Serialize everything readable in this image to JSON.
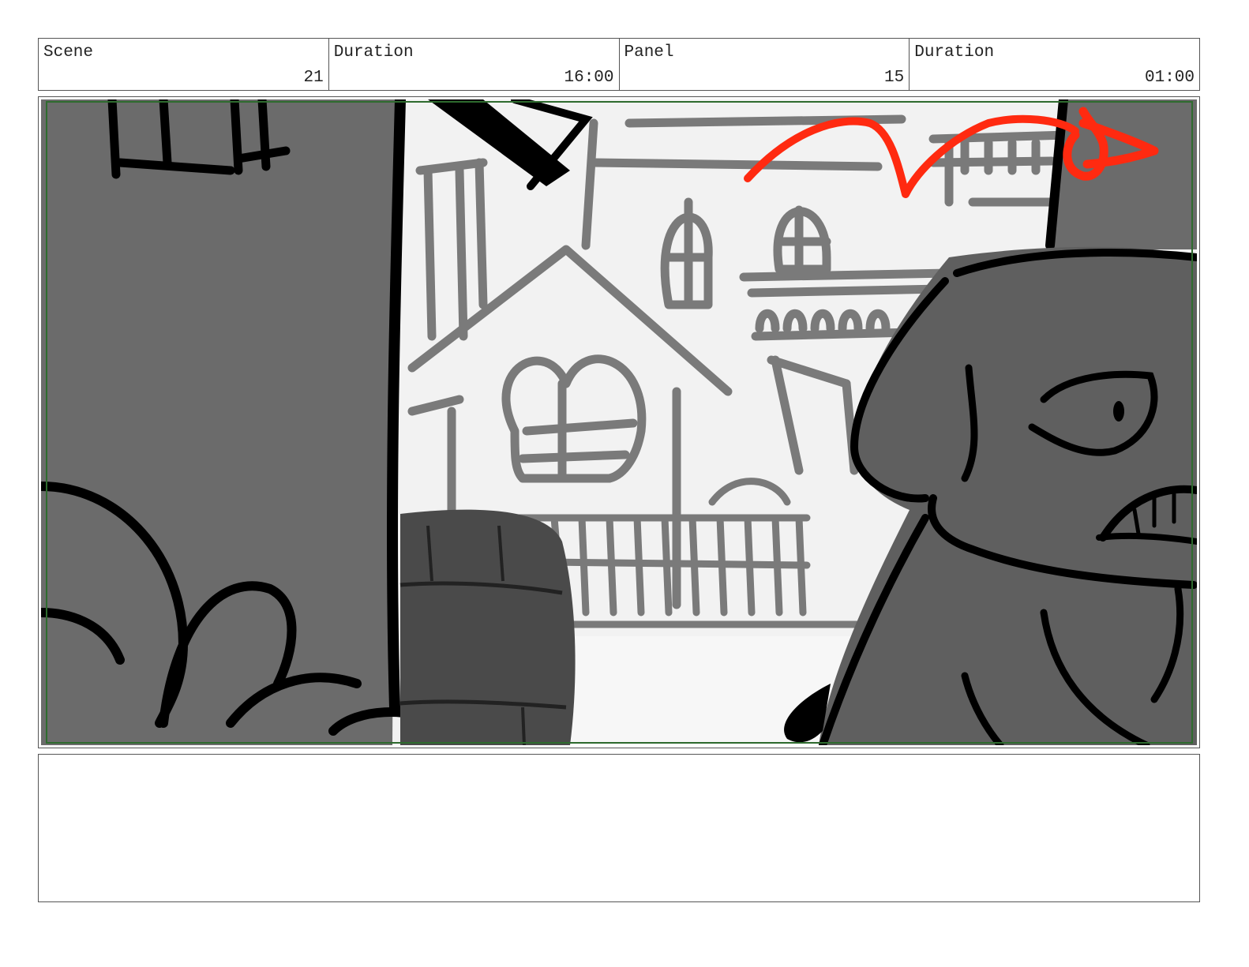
{
  "header": {
    "scene_label": "Scene",
    "scene_value": "21",
    "scene_duration_label": "Duration",
    "scene_duration_value": "16:00",
    "panel_label": "Panel",
    "panel_value": "15",
    "panel_duration_label": "Duration",
    "panel_duration_value": "01:00"
  },
  "panel": {
    "colors": {
      "safe_area_border": "#2e6b2e",
      "camera_move_arrow": "#ff2a10",
      "ink": "#000000",
      "wall_gray": "#6b6b6b",
      "background_light": "#f2f2f2",
      "line_gray": "#7a7a7a",
      "barrel_gray": "#4a4a4a",
      "character_gray": "#5f5f5f"
    }
  },
  "notes": {
    "text": ""
  }
}
